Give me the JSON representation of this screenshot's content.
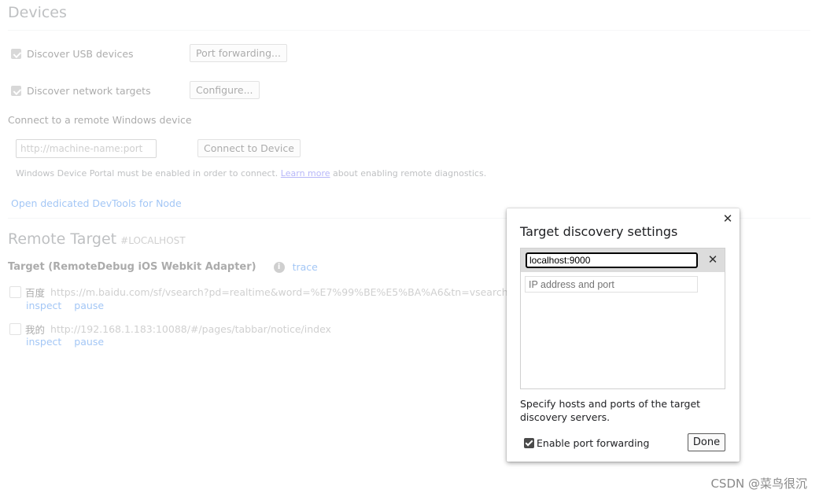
{
  "devices": {
    "title": "Devices",
    "discover_usb_label": "Discover USB devices",
    "port_forwarding_button": "Port forwarding...",
    "discover_network_label": "Discover network targets",
    "configure_button": "Configure...",
    "remote_windows_label": "Connect to a remote Windows device",
    "machine_input_placeholder": "http://machine-name:port",
    "connect_button": "Connect to Device",
    "portal_note_prefix": "Windows Device Portal must be enabled in order to connect.",
    "learn_more_link": "Learn more",
    "portal_note_suffix": "about enabling remote diagnostics.",
    "node_devtools_link": "Open dedicated DevTools for Node"
  },
  "remote_target": {
    "title": "Remote Target",
    "subtitle": "#LOCALHOST",
    "target_title": "Target (RemoteDebug iOS Webkit Adapter)",
    "info_icon": "i",
    "trace_link": "trace",
    "targets": [
      {
        "name": "百度",
        "url": "https://m.baidu.com/sf/vsearch?pd=realtime&word=%E7%99%BE%E5%BA%A6&tn=vsearch&sa=vs_",
        "inspect": "inspect",
        "pause": "pause"
      },
      {
        "name": "我的",
        "url": "http://192.168.1.183:10088/#/pages/tabbar/notice/index",
        "inspect": "inspect",
        "pause": "pause"
      }
    ]
  },
  "dialog": {
    "title": "Target discovery settings",
    "close_icon": "close-icon",
    "edited_entry_value": "localhost:9000",
    "remove_icon": "close-icon",
    "new_entry_placeholder": "IP address and port",
    "description": "Specify hosts and ports of the target discovery servers.",
    "enable_port_forwarding_label": "Enable port forwarding",
    "done_button": "Done"
  },
  "watermark": "CSDN @菜鸟很沉"
}
